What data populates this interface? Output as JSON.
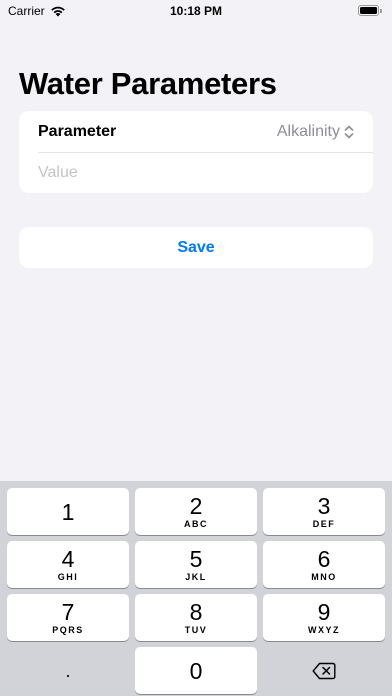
{
  "status_bar": {
    "carrier": "Carrier",
    "time": "10:18 PM"
  },
  "page": {
    "title": "Water Parameters"
  },
  "form": {
    "parameter_label": "Parameter",
    "parameter_value": "Alkalinity",
    "value_placeholder": "Value",
    "value": ""
  },
  "actions": {
    "save_label": "Save"
  },
  "colors": {
    "accent": "#007aff",
    "background": "#f2f2f7",
    "keyboard_bg": "#d1d3d9"
  },
  "keyboard": {
    "keys": [
      {
        "digit": "1",
        "letters": ""
      },
      {
        "digit": "2",
        "letters": "ABC"
      },
      {
        "digit": "3",
        "letters": "DEF"
      },
      {
        "digit": "4",
        "letters": "GHI"
      },
      {
        "digit": "5",
        "letters": "JKL"
      },
      {
        "digit": "6",
        "letters": "MNO"
      },
      {
        "digit": "7",
        "letters": "PQRS"
      },
      {
        "digit": "8",
        "letters": "TUV"
      },
      {
        "digit": "9",
        "letters": "WXYZ"
      },
      {
        "digit": ".",
        "letters": ""
      },
      {
        "digit": "0",
        "letters": ""
      }
    ],
    "delete_icon": "delete-backward-icon"
  }
}
